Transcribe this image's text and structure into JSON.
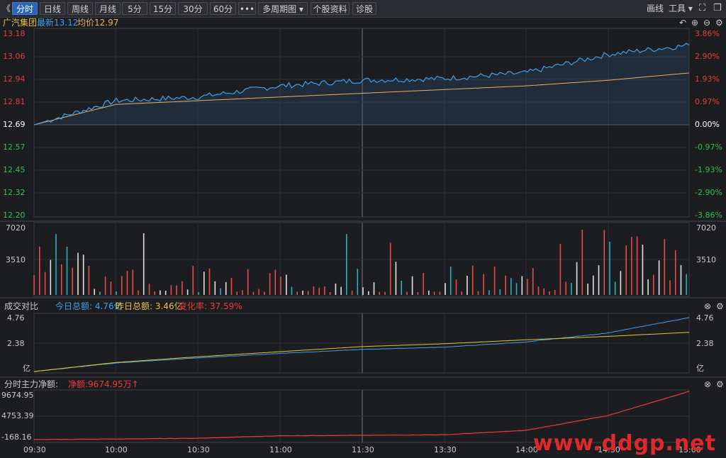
{
  "toolbar": {
    "collapse_icon": "double-chevron-left-icon",
    "tabs": [
      {
        "label": "分时",
        "active": true
      },
      {
        "label": "日线"
      },
      {
        "label": "周线"
      },
      {
        "label": "月线"
      },
      {
        "label": "5分"
      },
      {
        "label": "15分"
      },
      {
        "label": "30分"
      },
      {
        "label": "60分"
      },
      {
        "label": "•••"
      },
      {
        "label": "多周期图 ▾"
      },
      {
        "label": "个股资料"
      },
      {
        "label": "诊股"
      }
    ],
    "draw_label": "画线",
    "tools_label": "工具 ▾",
    "fullscreen_icon": "expand-icon",
    "restore_icon": "restore-window-icon"
  },
  "stock": {
    "name": "广汽集团",
    "latest": "最新13.12",
    "avg": "均价12.97"
  },
  "price_chart": {
    "left_ticks": [
      "13.18",
      "13.06",
      "12.94",
      "12.81",
      "12.69",
      "12.57",
      "12.45",
      "12.32",
      "12.20"
    ],
    "right_ticks": [
      "3.86%",
      "2.90%",
      "1.93%",
      "0.97%",
      "0.00%",
      "-0.97%",
      "-1.93%",
      "-2.90%",
      "-3.86%"
    ],
    "ticks_up_color": "#e83a3a",
    "ticks_down_color": "#2fbf4f",
    "ticks_flat_color": "#ffffff",
    "icons": [
      "undo-icon",
      "zoom-in-icon",
      "zoom-out-icon",
      "gear-icon"
    ]
  },
  "volume_chart": {
    "left_ticks": [
      "7020",
      "3510"
    ],
    "right_ticks": [
      "7020",
      "3510"
    ]
  },
  "turnover_chart": {
    "title": "成交对比",
    "today": "今日总额: 4.76亿",
    "yesterday": "昨日总额: 3.46亿",
    "change": "变化率: 37.59%",
    "left_ticks": [
      "4.76",
      "2.38",
      "亿"
    ],
    "right_ticks": [
      "4.76",
      "2.38",
      "亿"
    ],
    "icons": [
      "close-icon",
      "gear-icon"
    ]
  },
  "netflow_chart": {
    "title": "分时主力净额:",
    "net": "净额:9674.95万↑",
    "left_ticks": [
      "9674.95",
      "4753.39",
      "-168.16"
    ],
    "icons": [
      "close-icon",
      "gear-icon"
    ]
  },
  "time_axis": [
    "09:30",
    "10:00",
    "10:30",
    "11:00",
    "11:30",
    "13:30",
    "14:00",
    "14:30",
    "15:00"
  ],
  "watermark": "www.ddgp.net",
  "colors": {
    "price_line": "#3f9ee8",
    "avg_line": "#e6b35a",
    "today_line": "#3f9ee8",
    "yesterday_line": "#e8c23a",
    "net_line": "#e83a3a"
  },
  "chart_data": [
    {
      "type": "line",
      "title": "广汽集团",
      "x": [
        "09:30",
        "10:00",
        "10:30",
        "11:00",
        "11:30",
        "13:30",
        "14:00",
        "14:30",
        "15:00"
      ],
      "series": [
        {
          "name": "最新",
          "values": [
            12.69,
            12.82,
            12.84,
            12.9,
            12.93,
            12.94,
            12.97,
            13.07,
            13.12
          ]
        },
        {
          "name": "均价",
          "values": [
            12.69,
            12.8,
            12.82,
            12.84,
            12.86,
            12.88,
            12.9,
            12.93,
            12.97
          ]
        }
      ],
      "ylim": [
        12.2,
        13.18
      ]
    },
    {
      "type": "bar",
      "title": "",
      "ylim": [
        0,
        7020
      ]
    },
    {
      "type": "line",
      "title": "成交对比",
      "x": [
        "09:30",
        "10:00",
        "10:30",
        "11:00",
        "11:30",
        "13:30",
        "14:00",
        "14:30",
        "15:00"
      ],
      "series": [
        {
          "name": "今日总额",
          "values": [
            0.0,
            0.75,
            1.2,
            1.6,
            1.95,
            2.15,
            2.6,
            3.4,
            4.76
          ]
        },
        {
          "name": "昨日总额",
          "values": [
            0.0,
            0.8,
            1.3,
            1.75,
            2.2,
            2.45,
            2.8,
            3.1,
            3.46
          ]
        }
      ],
      "ylim": [
        0,
        4.76
      ]
    },
    {
      "type": "line",
      "title": "分时主力净额",
      "x": [
        "09:30",
        "10:00",
        "10:30",
        "11:00",
        "11:30",
        "13:30",
        "14:00",
        "14:30",
        "15:00"
      ],
      "series": [
        {
          "name": "净额",
          "values": [
            -168.16,
            -50,
            100,
            600,
            700,
            800,
            1700,
            4700,
            9674.95
          ]
        }
      ],
      "ylim": [
        -168.16,
        9674.95
      ]
    }
  ]
}
